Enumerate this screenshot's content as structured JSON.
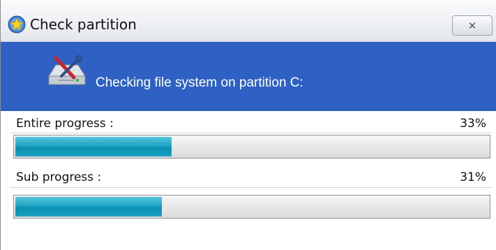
{
  "window": {
    "title": "Check partition",
    "close_symbol": "✕"
  },
  "header": {
    "message": "Checking file system on partition C:",
    "icon": "disk-check-icon",
    "background_color": "#2f61c4"
  },
  "progress": {
    "entire": {
      "label": "Entire progress :",
      "percent_text": "33%",
      "value": 0.33
    },
    "sub": {
      "label": "Sub progress :",
      "percent_text": "31%",
      "value": 0.31
    }
  },
  "colors": {
    "progress_fill": "#1fa5c4"
  }
}
